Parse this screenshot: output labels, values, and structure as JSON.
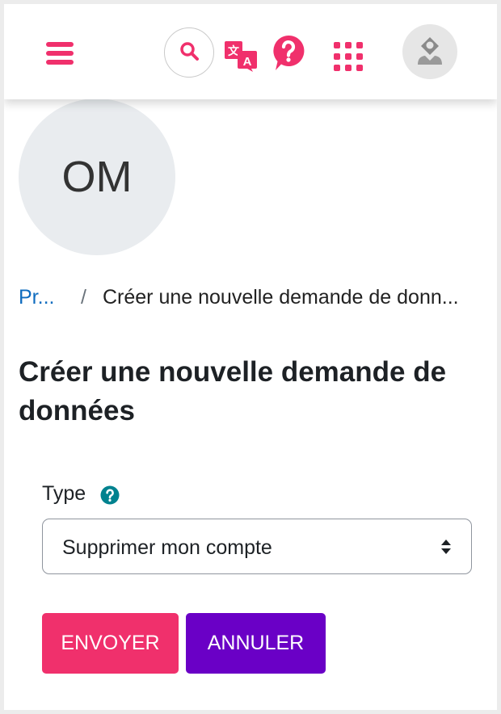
{
  "header": {
    "menu_icon": "hamburger-menu-icon",
    "search_icon": "search-icon",
    "language_icon": "translate-icon",
    "help_icon": "help-icon",
    "apps_icon": "apps-grid-icon",
    "user_icon": "user-avatar-icon"
  },
  "profile": {
    "initials": "OM"
  },
  "breadcrumb": {
    "items": [
      {
        "label": "Pr..."
      },
      {
        "label": "Créer une nouvelle demande de donn..."
      }
    ],
    "separator": "/"
  },
  "page": {
    "title": "Créer une nouvelle demande de données"
  },
  "form": {
    "type_label": "Type",
    "type_help_icon": "question-circle-icon",
    "type_value": "Supprimer mon compte",
    "submit_label": "ENVOYER",
    "cancel_label": "ANNULER"
  },
  "colors": {
    "accent": "#f0306c",
    "secondary_button": "#6a00c6",
    "link": "#0f6cbf",
    "help_icon": "#00828f",
    "avatar_bg": "#e9ecef"
  }
}
